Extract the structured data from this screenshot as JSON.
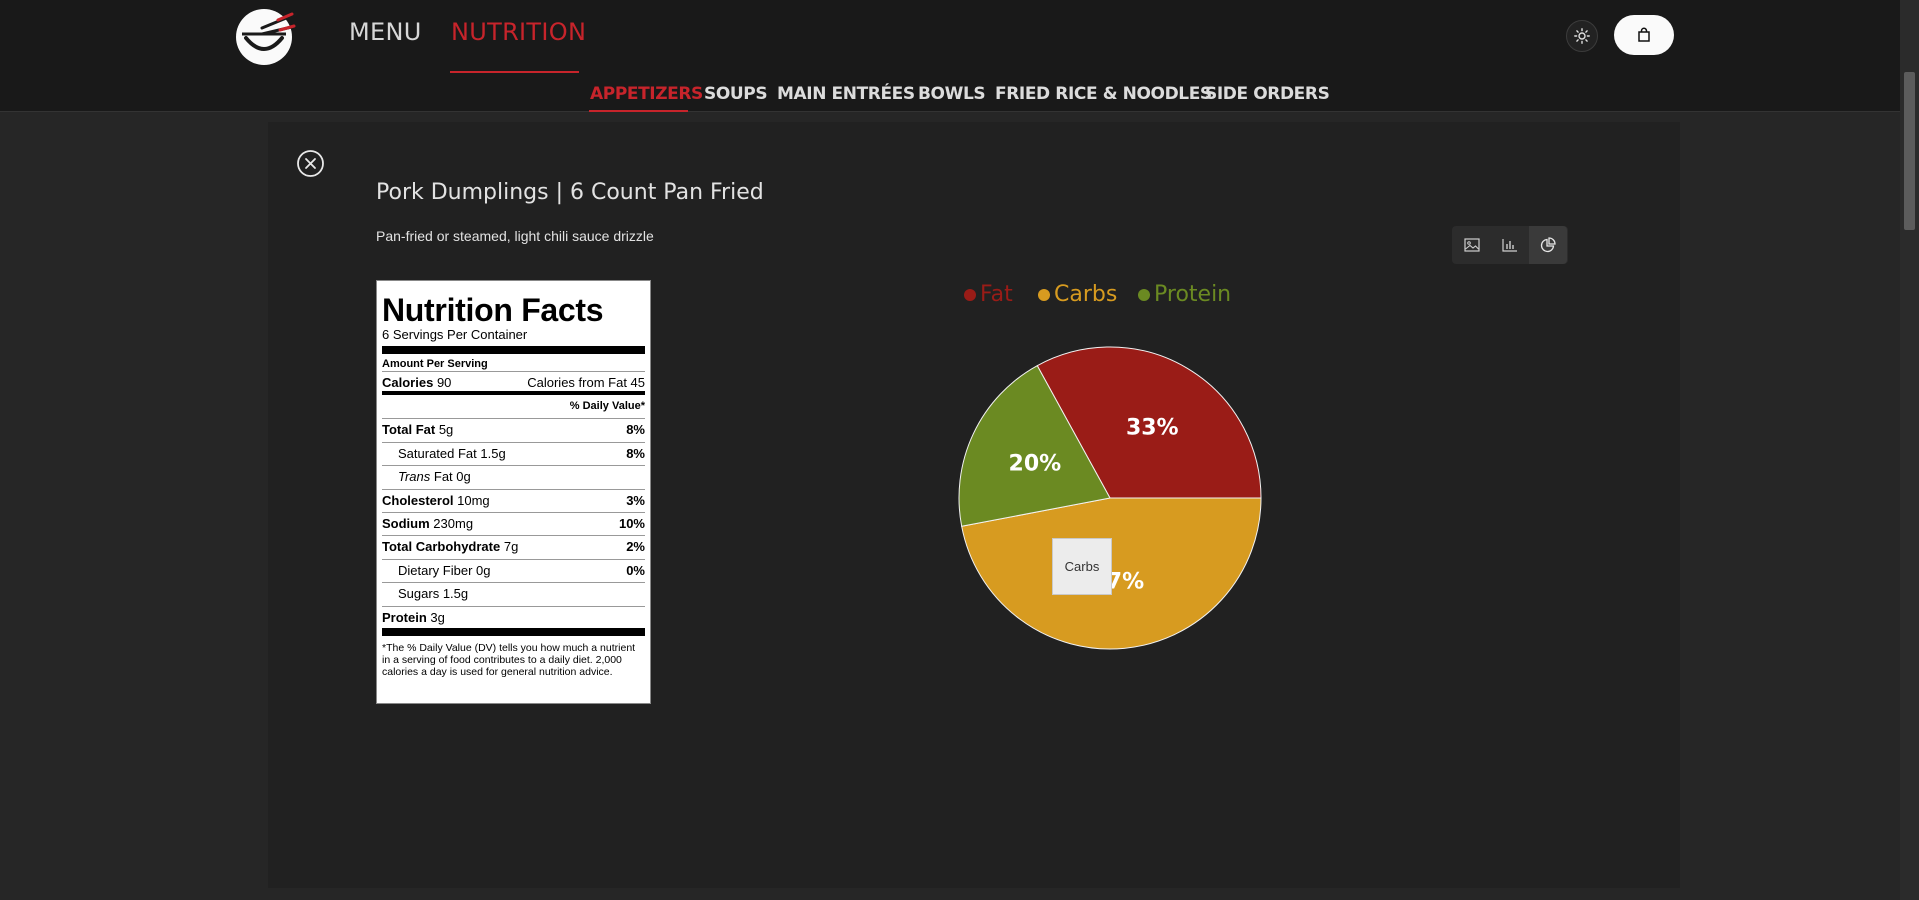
{
  "header": {
    "logo_icon": "ramen-bowl-chopsticks-icon",
    "nav": [
      {
        "label": "MENU",
        "active": false
      },
      {
        "label": "NUTRITION",
        "active": true
      }
    ],
    "theme_icon": "sun-icon",
    "cart_icon": "shopping-bag-icon"
  },
  "categories": [
    {
      "label": "APPETIZERS",
      "active": true
    },
    {
      "label": "SOUPS",
      "active": false
    },
    {
      "label": "MAIN ENTRÉES",
      "active": false
    },
    {
      "label": "BOWLS",
      "active": false
    },
    {
      "label": "FRIED RICE & NOODLES",
      "active": false
    },
    {
      "label": "SIDE ORDERS",
      "active": false
    }
  ],
  "item": {
    "title": "Pork Dumplings | 6 Count Pan Fried",
    "description": "Pan-fried or steamed, light chili sauce drizzle",
    "close_icon": "close-circle-icon",
    "view_buttons": [
      {
        "icon": "image-icon",
        "active": false
      },
      {
        "icon": "bar-chart-icon",
        "active": false
      },
      {
        "icon": "pie-chart-icon",
        "active": true
      }
    ]
  },
  "nutrition_facts": {
    "heading": "Nutrition Facts",
    "servings": "6 Servings Per Container",
    "amount_per_serving": "Amount Per Serving",
    "calories_label": "Calories",
    "calories_value": "90",
    "calories_from_fat": "Calories from Fat 45",
    "daily_value_header": "% Daily Value*",
    "total_fat": {
      "label": "Total Fat",
      "amount": "5g",
      "dv": "8%"
    },
    "saturated_fat": {
      "label": "Saturated Fat",
      "amount": "1.5g",
      "dv": "8%"
    },
    "trans_fat": {
      "label_italic": "Trans",
      "label": " Fat",
      "amount": "0g"
    },
    "cholesterol": {
      "label": "Cholesterol",
      "amount": "10mg",
      "dv": "3%"
    },
    "sodium": {
      "label": "Sodium",
      "amount": "230mg",
      "dv": "10%"
    },
    "total_carbohydrate": {
      "label": "Total Carbohydrate",
      "amount": "7g",
      "dv": "2%"
    },
    "dietary_fiber": {
      "label": "Dietary Fiber",
      "amount": "0g",
      "dv": "0%"
    },
    "sugars": {
      "label": "Sugars",
      "amount": "1.5g"
    },
    "protein": {
      "label": "Protein",
      "amount": "3g"
    },
    "footnote": "*The % Daily Value (DV) tells you how much a nutrient in a serving of food contributes to a daily diet. 2,000 calories a day is used for general nutrition advice."
  },
  "tooltip": {
    "label": "Carbs"
  },
  "chart_data": {
    "type": "pie",
    "legend_position": "top",
    "categories": [
      "Fat",
      "Carbs",
      "Protein"
    ],
    "values": [
      33,
      47,
      20
    ],
    "labels": [
      "33%",
      "47%",
      "20%"
    ],
    "colors": [
      "#9a1c17",
      "#d79b20",
      "#6b8a22"
    ]
  }
}
